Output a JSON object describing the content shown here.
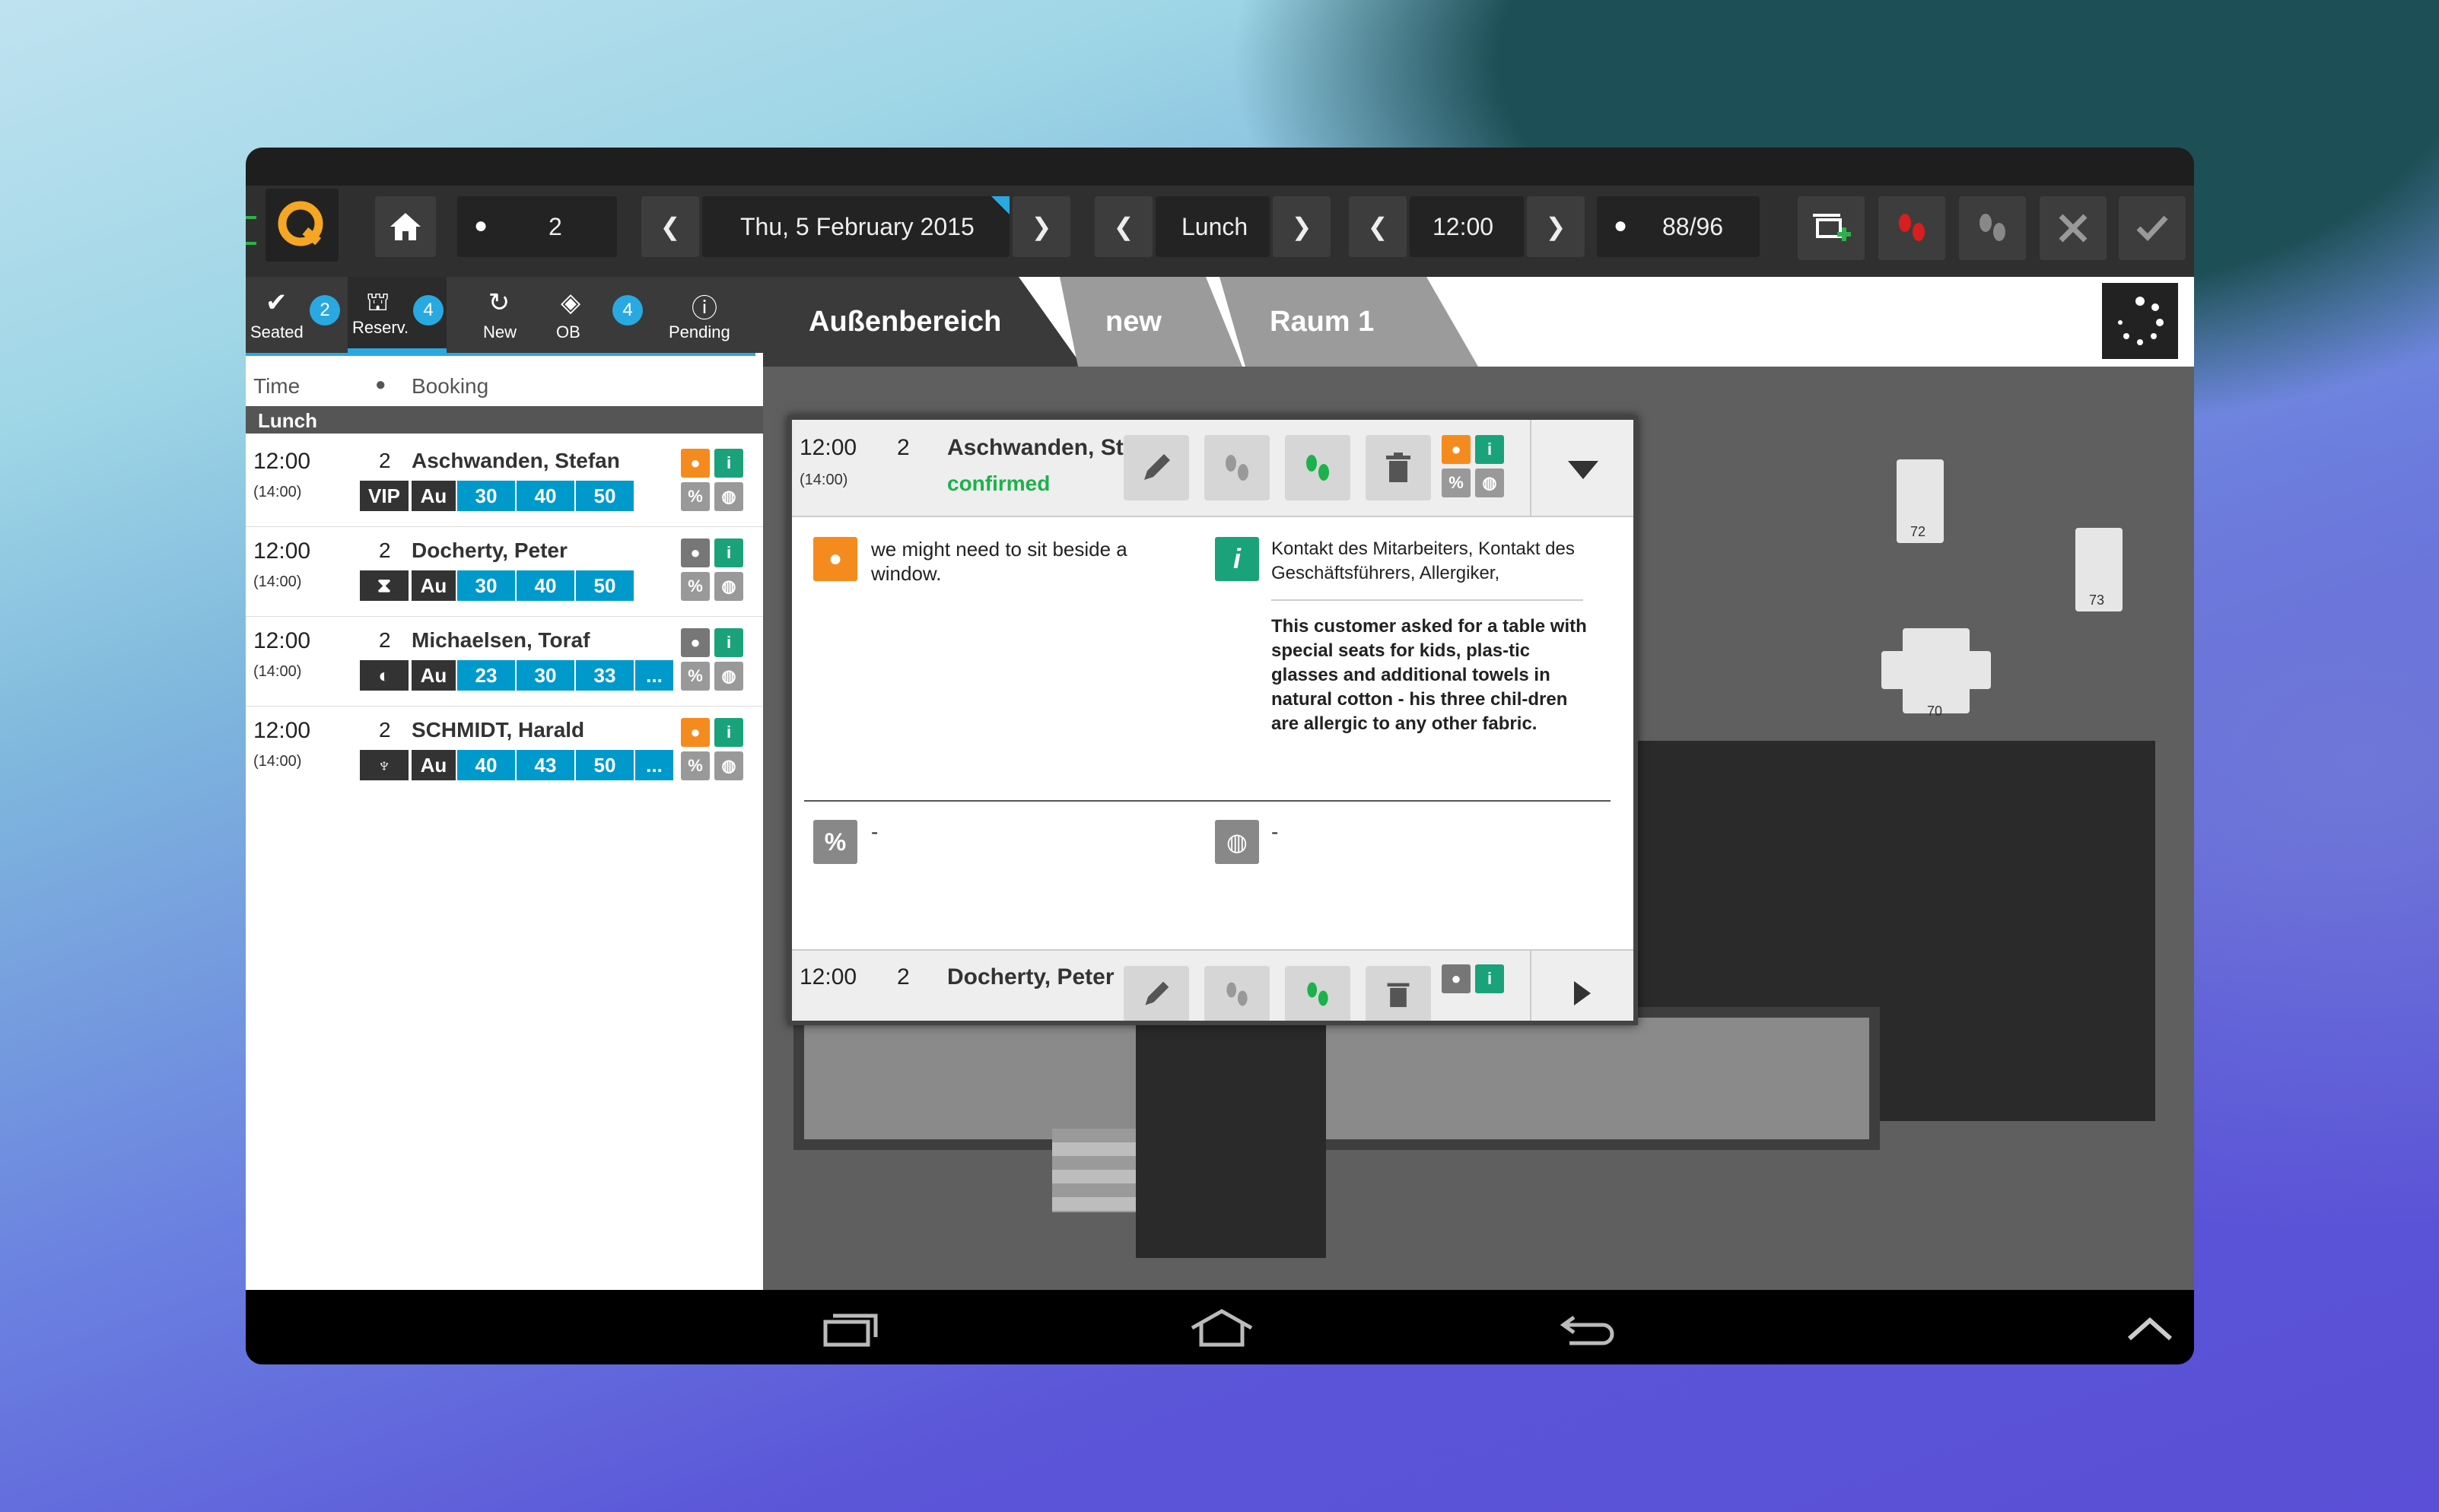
{
  "topbar": {
    "guests_count": "2",
    "date": "Thu, 5 February 2015",
    "service": "Lunch",
    "time": "12:00",
    "capacity": "88/96",
    "prev": "❮",
    "next": "❯"
  },
  "tabs": [
    {
      "label": "Seated",
      "icon": "✔",
      "badge": "2"
    },
    {
      "label": "Reserv.",
      "icon": "⛫",
      "badge": "4"
    },
    {
      "label": "New",
      "icon": "↻",
      "badge": ""
    },
    {
      "label": "OB",
      "icon": "◈",
      "badge": "4"
    },
    {
      "label": "Pending",
      "icon": "ⓘ",
      "badge": ""
    }
  ],
  "list_header": {
    "time": "Time",
    "booking": "Booking",
    "section": "Lunch"
  },
  "reservations": [
    {
      "time": "12:00",
      "end": "(14:00)",
      "guests": "2",
      "name": "Aschwanden, Stefan",
      "tag": "VIP",
      "area": "Au",
      "tables": [
        "30",
        "40",
        "50"
      ],
      "more": ""
    },
    {
      "time": "12:00",
      "end": "(14:00)",
      "guests": "2",
      "name": "Docherty, Peter",
      "tag": "⧗",
      "area": "Au",
      "tables": [
        "30",
        "40",
        "50"
      ],
      "more": ""
    },
    {
      "time": "12:00",
      "end": "(14:00)",
      "guests": "2",
      "name": "Michaelsen, Toraf",
      "tag": "◐",
      "area": "Au",
      "tables": [
        "23",
        "30",
        "33"
      ],
      "more": "..."
    },
    {
      "time": "12:00",
      "end": "(14:00)",
      "guests": "2",
      "name": "SCHMIDT, Harald",
      "tag": "♆",
      "area": "Au",
      "tables": [
        "40",
        "43",
        "50"
      ],
      "more": "..."
    }
  ],
  "rooms": [
    "Außenbereich",
    "new",
    "Raum 1"
  ],
  "popup": {
    "time": "12:00",
    "end": "(14:00)",
    "guests": "2",
    "name": "Aschwanden, St...",
    "status": "confirmed",
    "comment": "we might need to sit beside a window.",
    "info_title": "Kontakt des Mitarbeiters, Kontakt des Geschäftsführers, Allergiker,",
    "info_body": "This customer asked for a table with special seats for kids, plas-tic glasses and additional towels in natural cotton - his three chil-dren are allergic to any other fabric.",
    "discount": "-",
    "web": "-",
    "next_time": "12:00",
    "next_guests": "2",
    "next_name": "Docherty, Peter"
  },
  "tables": [
    "72",
    "73",
    "70"
  ],
  "colors": {
    "accent": "#f5a623",
    "blue": "#0099cc",
    "green": "#1bb24b",
    "orange": "#f58b1f",
    "teal": "#1aa37a"
  }
}
